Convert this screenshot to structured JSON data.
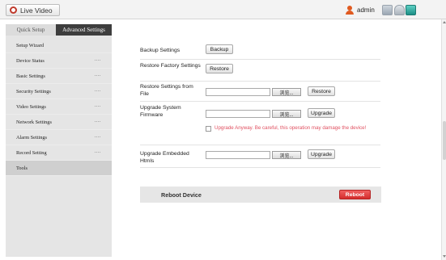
{
  "topbar": {
    "live_video_label": "Live Video",
    "live_icon": "camera-record-icon",
    "user_name": "admin",
    "user_icon": "user-icon",
    "tool_icons": [
      "grid-icon",
      "headset-icon",
      "monitor-icon"
    ]
  },
  "tabs": {
    "quick_setup": "Quick Setup",
    "advanced_settings": "Advanced Settings",
    "active": "Advanced Settings"
  },
  "sidebar": {
    "items": [
      {
        "label": "Setup Wizard",
        "has_submenu": false
      },
      {
        "label": "Device Status",
        "has_submenu": true
      },
      {
        "label": "Basic Settings",
        "has_submenu": true
      },
      {
        "label": "Security Settings",
        "has_submenu": true
      },
      {
        "label": "Video Settings",
        "has_submenu": true
      },
      {
        "label": "Network Settings",
        "has_submenu": true
      },
      {
        "label": "Alarm Settings",
        "has_submenu": true
      },
      {
        "label": "Record Setting",
        "has_submenu": true
      },
      {
        "label": "Tools",
        "has_submenu": false,
        "active": true
      }
    ]
  },
  "tools": {
    "backup": {
      "label": "Backup Settings",
      "button": "Backup"
    },
    "restore_factory": {
      "label": "Restore Factory Settings",
      "button": "Restore"
    },
    "restore_file": {
      "label": "Restore Settings from File",
      "browse": "浏览...",
      "button": "Restore"
    },
    "upgrade_firmware": {
      "label": "Upgrade System Firmware",
      "browse": "浏览...",
      "button": "Upgrade"
    },
    "upgrade_anyway": {
      "label": "Upgrade Anyway. Be careful, this operation may damage the device!",
      "checked": false
    },
    "upgrade_htmls": {
      "label": "Upgrade Embedded Htmls",
      "browse": "浏览...",
      "button": "Upgrade"
    },
    "reboot": {
      "label": "Reboot Device",
      "button": "Reboot"
    }
  },
  "colors": {
    "accent_red": "#d42c2c",
    "warning_text": "#e05060",
    "sidebar_bg": "#e5e5e5",
    "active_tab_bg": "#3d3d3d"
  }
}
